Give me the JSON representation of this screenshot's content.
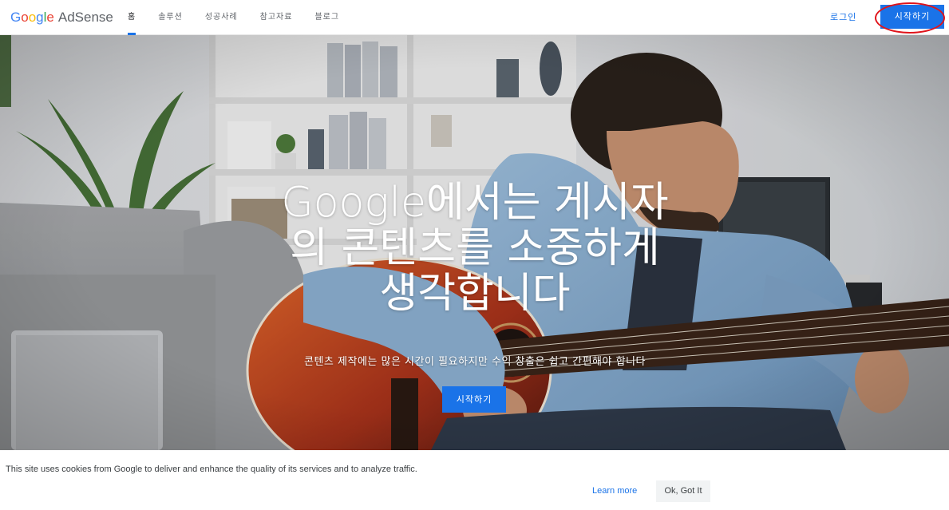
{
  "header": {
    "logo": {
      "letters": [
        "G",
        "o",
        "o",
        "g",
        "l",
        "e"
      ],
      "product": "AdSense"
    },
    "nav": [
      {
        "label": "홈",
        "active": true
      },
      {
        "label": "솔루션",
        "active": false
      },
      {
        "label": "성공사례",
        "active": false
      },
      {
        "label": "참고자료",
        "active": false
      },
      {
        "label": "블로그",
        "active": false
      }
    ],
    "login_label": "로그인",
    "start_label": "시작하기"
  },
  "hero": {
    "headline_lines": [
      "Google에서는 게시자",
      "의 콘텐츠를 소중하게",
      "생각합니다"
    ],
    "subtitle": "콘텐츠 제작에는 많은 시간이 필요하지만 수익 창출은 쉽고 간편해야 합니다",
    "cta_label": "시작하기"
  },
  "cookie_bar": {
    "text": "This site uses cookies from Google to deliver and enhance the quality of its services and to analyze traffic.",
    "learn_more": "Learn more",
    "ok_label": "Ok, Got It"
  },
  "colors": {
    "accent": "#1a73e8",
    "highlight_ring": "#e0141b"
  }
}
